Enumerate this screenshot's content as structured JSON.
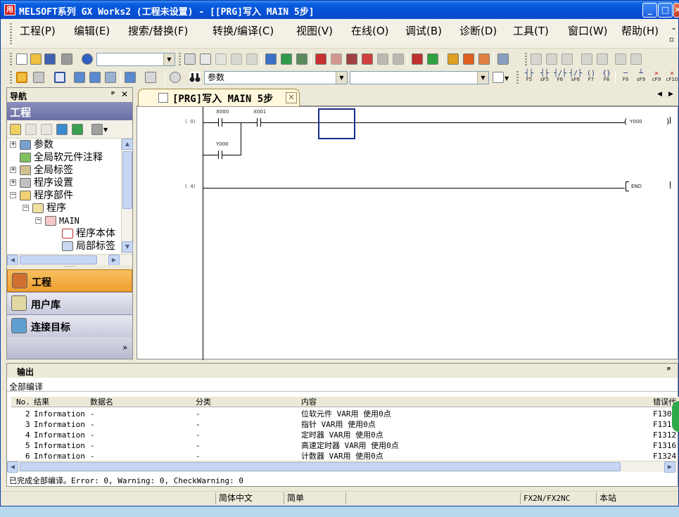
{
  "window": {
    "title": "MELSOFT系列 GX Works2 (工程未设置) - [[PRG]写入 MAIN 5步]",
    "app_icon": "gxworks-app-icon"
  },
  "menu": [
    "工程(P)",
    "编辑(E)",
    "搜索/替换(F)",
    "转换/编译(C)",
    "视图(V)",
    "在线(O)",
    "调试(B)",
    "诊断(D)",
    "工具(T)",
    "窗口(W)",
    "帮助(H)"
  ],
  "toolbar": {
    "combo1_value": "",
    "search_combo_value": "参数",
    "combo3_value": ""
  },
  "fkeys": [
    "F5",
    "sF5",
    "F6",
    "sF6",
    "F7",
    "F8",
    "F9",
    "sF9",
    "cF9",
    "cF10"
  ],
  "nav": {
    "header": "导航",
    "pin": "ᵖ",
    "close": "✕",
    "project_label": "工程",
    "tree": [
      {
        "label": "参数",
        "expand": "+",
        "indent": 0
      },
      {
        "label": "全局软元件注释",
        "expand": "",
        "indent": 0
      },
      {
        "label": "全局标签",
        "expand": "+",
        "indent": 0
      },
      {
        "label": "程序设置",
        "expand": "+",
        "indent": 0
      },
      {
        "label": "程序部件",
        "expand": "−",
        "indent": 0
      },
      {
        "label": "程序",
        "expand": "−",
        "indent": 1
      },
      {
        "label": "MAIN",
        "expand": "−",
        "indent": 2
      },
      {
        "label": "程序本体",
        "expand": "",
        "indent": 3
      },
      {
        "label": "局部标签",
        "expand": "",
        "indent": 3
      }
    ],
    "buttons": [
      "工程",
      "用户库",
      "连接目标"
    ],
    "more": "»"
  },
  "editor": {
    "tab_label": "[PRG]写入 MAIN 5步",
    "rungs": [
      {
        "step": "0"
      },
      {
        "step": "4"
      }
    ],
    "devices": {
      "c1": "X000",
      "c2": "X001",
      "c3": "Y000",
      "coil": "Y000",
      "end": "END"
    }
  },
  "output": {
    "header": "输出",
    "subtitle": "全部编译",
    "columns": [
      "No.",
      "结果",
      "数据名",
      "分类",
      "内容",
      "错误代"
    ],
    "rows": [
      {
        "no": "2",
        "result": "Information",
        "data": "-",
        "cat": "-",
        "content": "位软元件 VAR用 使用0点",
        "code": "F1306"
      },
      {
        "no": "3",
        "result": "Information",
        "data": "-",
        "cat": "-",
        "content": "指针 VAR用 使用0点",
        "code": "F1310"
      },
      {
        "no": "4",
        "result": "Information",
        "data": "-",
        "cat": "-",
        "content": "定时器 VAR用 使用0点",
        "code": "F1312"
      },
      {
        "no": "5",
        "result": "Information",
        "data": "-",
        "cat": "-",
        "content": "高速定时器 VAR用 使用0点",
        "code": "F1316"
      },
      {
        "no": "6",
        "result": "Information",
        "data": "-",
        "cat": "-",
        "content": "计数器 VAR用 使用0点",
        "code": "F1324"
      }
    ],
    "status": "已完成全部编译。Error: 0, Warning: 0, CheckWarning: 0"
  },
  "statusbar": {
    "lang": "简体中文",
    "mode": "简单",
    "plc": "FX2N/FX2NC",
    "station": "本站"
  }
}
